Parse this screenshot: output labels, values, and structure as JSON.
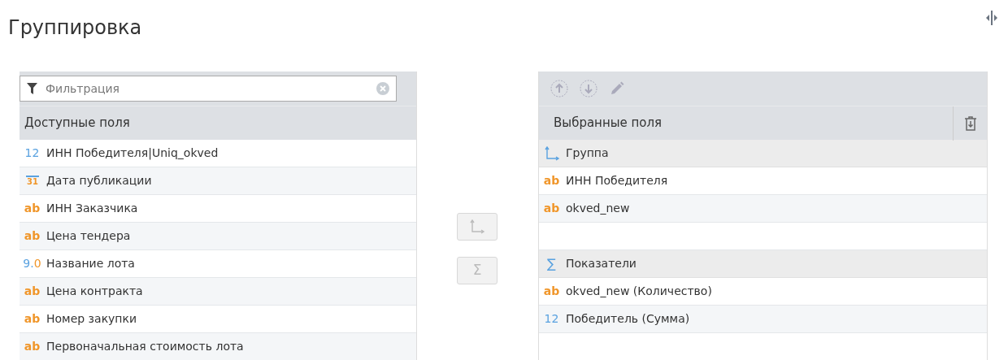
{
  "title": "Группировка",
  "filter": {
    "placeholder": "Фильтрация"
  },
  "available": {
    "header": "Доступные поля",
    "items": [
      {
        "kind": "number",
        "type_label": "12",
        "label": "ИНН Победителя|Uniq_okved"
      },
      {
        "kind": "date",
        "type_label": "31",
        "label": "Дата публикации"
      },
      {
        "kind": "text",
        "type_label": "ab",
        "label": "ИНН Заказчика"
      },
      {
        "kind": "text",
        "type_label": "ab",
        "label": "Цена тендера"
      },
      {
        "kind": "float",
        "type_label": "9.0",
        "label": "Название лота"
      },
      {
        "kind": "text",
        "type_label": "ab",
        "label": "Цена контракта"
      },
      {
        "kind": "text",
        "type_label": "ab",
        "label": "Номер закупки"
      },
      {
        "kind": "text",
        "type_label": "ab",
        "label": "Первоначальная стоимость лота"
      }
    ]
  },
  "move_buttons": [
    {
      "kind": "group",
      "disabled": true
    },
    {
      "kind": "measure",
      "symbol": "Σ",
      "disabled": true
    }
  ],
  "selected": {
    "header": "Выбранные поля",
    "sections": [
      {
        "kind": "group",
        "label": "Группа",
        "items": [
          {
            "kind": "text",
            "type_label": "ab",
            "label": "ИНН Победителя"
          },
          {
            "kind": "text",
            "type_label": "ab",
            "label": "okved_new"
          }
        ]
      },
      {
        "kind": "measure",
        "symbol": "∑",
        "label": "Показатели",
        "items": [
          {
            "kind": "text",
            "type_label": "ab",
            "label": "okved_new (Количество)"
          },
          {
            "kind": "number",
            "type_label": "12",
            "label": "Победитель (Сумма)"
          }
        ]
      }
    ]
  }
}
